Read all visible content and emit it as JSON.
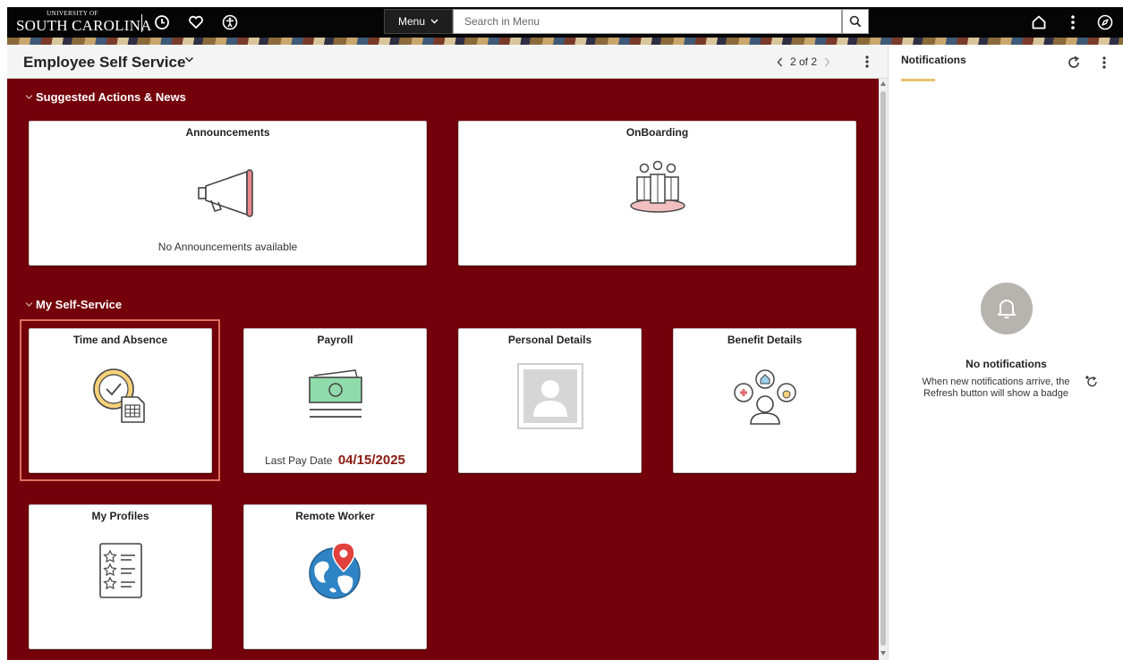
{
  "header": {
    "logo_line1": "UNIVERSITY OF",
    "logo_line2": "SOUTH CAROLINA",
    "menu_label": "Menu",
    "search_placeholder": "Search in Menu",
    "icons_left": [
      "clock-icon",
      "heart-icon",
      "accessibility-icon"
    ],
    "icons_right": [
      "home-icon",
      "kebab-menu-icon",
      "compass-icon"
    ]
  },
  "page": {
    "title": "Employee Self Service",
    "pager": "2 of 2"
  },
  "sections": {
    "suggested": "Suggested Actions & News",
    "self_service": "My Self-Service"
  },
  "tiles": {
    "announcements": {
      "title": "Announcements",
      "subtitle": "No Announcements available",
      "icon": "megaphone-icon"
    },
    "onboarding": {
      "title": "OnBoarding",
      "icon": "team-group-icon"
    },
    "time_absence": {
      "title": "Time and Absence",
      "icon": "clock-timesheet-icon"
    },
    "payroll": {
      "title": "Payroll",
      "subtitle_label": "Last Pay Date",
      "subtitle_value": "04/15/2025",
      "icon": "money-bill-icon"
    },
    "personal_details": {
      "title": "Personal Details",
      "icon": "person-photo-icon"
    },
    "benefit_details": {
      "title": "Benefit Details",
      "icon": "benefits-person-icon"
    },
    "my_profiles": {
      "title": "My Profiles",
      "icon": "star-checklist-icon"
    },
    "remote_worker": {
      "title": "Remote Worker",
      "icon": "globe-location-icon"
    }
  },
  "notifications": {
    "title": "Notifications",
    "empty_title": "No notifications",
    "empty_message": "When new notifications arrive, the Refresh button will show a badge"
  },
  "colors": {
    "garnet": "#73000A",
    "topbar": "#050505",
    "highlight": "#E07060",
    "pay_date": "#8B1A10",
    "notif_accent": "#E5C46F"
  }
}
